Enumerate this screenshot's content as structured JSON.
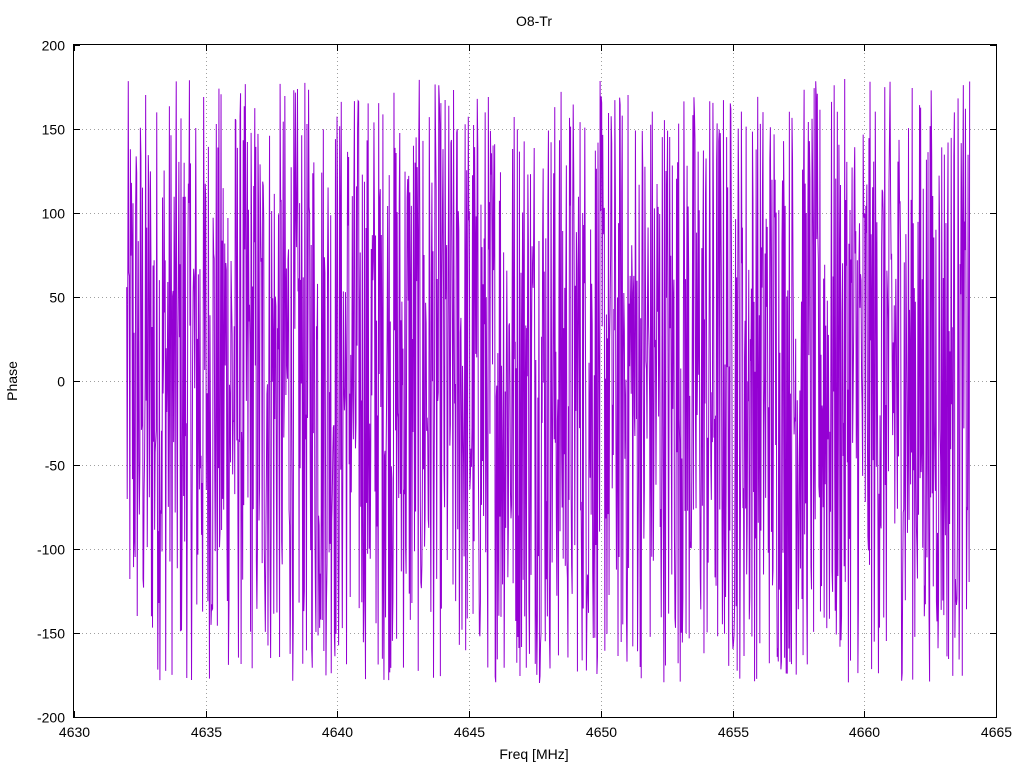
{
  "chart_data": {
    "type": "line",
    "title": "O8-Tr",
    "xlabel": "Freq [MHz]",
    "ylabel": "Phase",
    "xlim": [
      4630,
      4665
    ],
    "ylim": [
      -200,
      200
    ],
    "xticks": [
      4630,
      4635,
      4640,
      4645,
      4650,
      4655,
      4660,
      4665
    ],
    "yticks": [
      -200,
      -150,
      -100,
      -50,
      0,
      50,
      100,
      150,
      200
    ],
    "grid": true,
    "legend": "none",
    "series": [
      {
        "color": "#9400d3",
        "x_range": [
          4632,
          4664
        ],
        "y_range": [
          -180,
          180
        ],
        "description": "phase wrapped to [-180, 180], rapidly oscillating across the full range"
      }
    ]
  }
}
